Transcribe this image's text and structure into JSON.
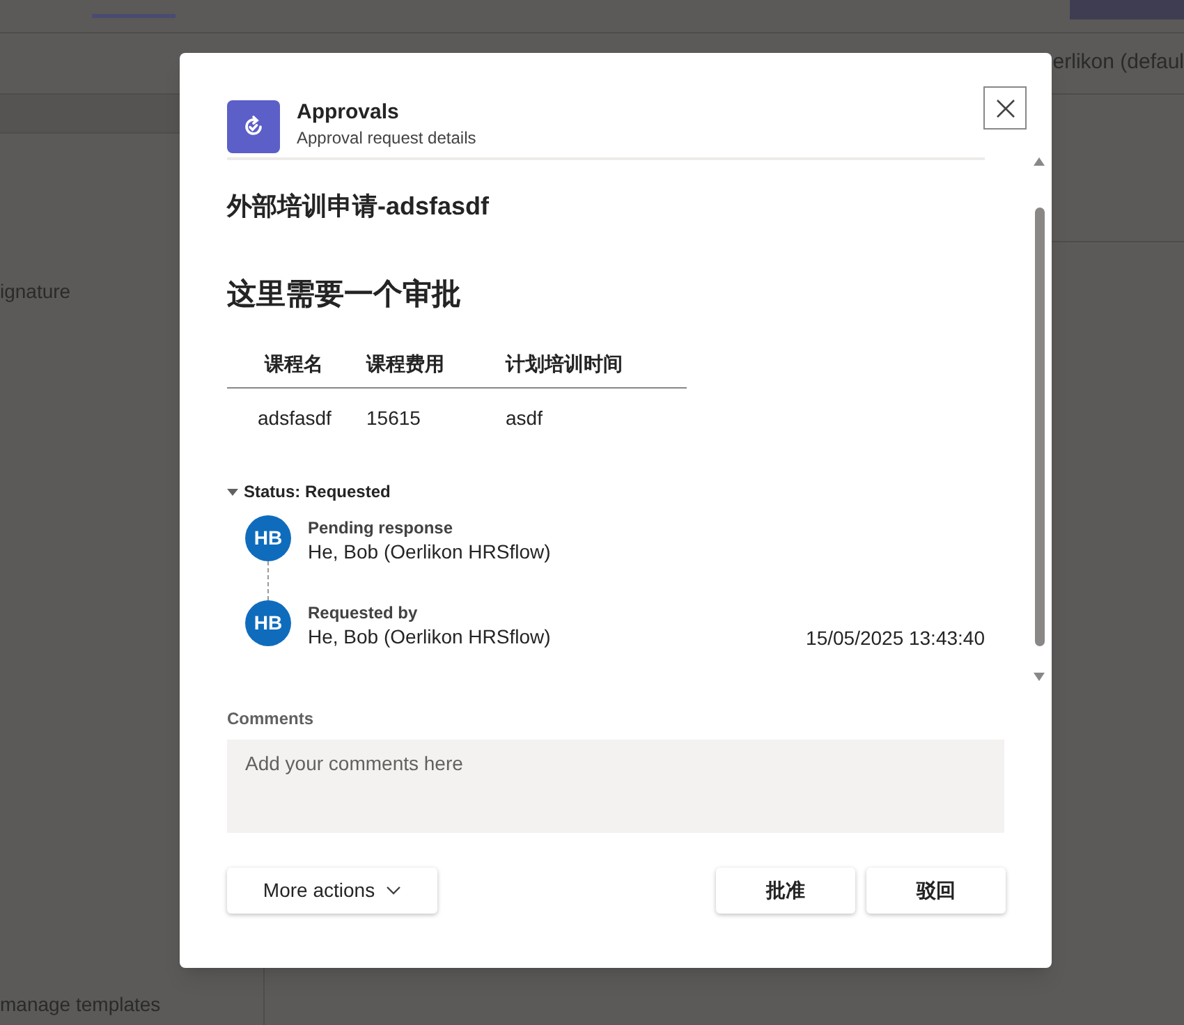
{
  "background": {
    "tenant_text": "erlikon (defaul",
    "row_text": "ignature",
    "link_text": "manage templates"
  },
  "dialog": {
    "app_name": "Approvals",
    "subtitle": "Approval request details",
    "title": "外部培训申请-adsfasdf",
    "heading": "这里需要一个审批",
    "table": {
      "columns": [
        "课程名",
        "课程费用",
        "计划培训时间"
      ],
      "rows": [
        [
          "adsfasdf",
          "15615",
          "asdf"
        ]
      ]
    },
    "status": {
      "label": "Status: Requested",
      "expanded": true
    },
    "timeline": [
      {
        "label": "Pending response",
        "initials": "HB",
        "name": "He, Bob (Oerlikon HRSflow)"
      },
      {
        "label": "Requested by",
        "initials": "HB",
        "name": "He, Bob (Oerlikon HRSflow)",
        "time": "15/05/2025 13:43:40"
      }
    ],
    "comments": {
      "label": "Comments",
      "placeholder": "Add your comments here"
    },
    "more_actions": "More actions",
    "actions": [
      "批准",
      "驳回"
    ]
  }
}
